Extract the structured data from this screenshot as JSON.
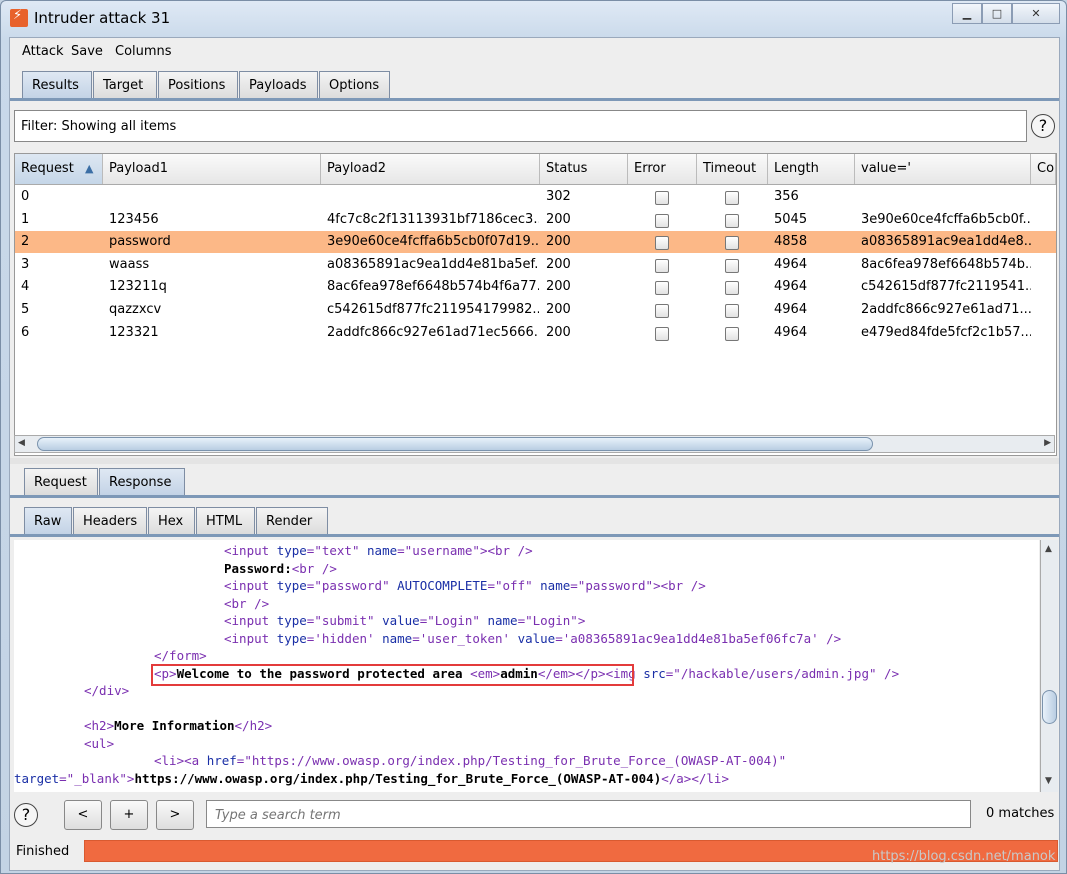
{
  "window": {
    "title": "Intruder attack 31",
    "controls": {
      "minimize": "▁",
      "maximize": "□",
      "close": "✕"
    }
  },
  "menu": [
    "Attack",
    "Save",
    "Columns"
  ],
  "main_tabs": [
    {
      "label": "Results",
      "active": true
    },
    {
      "label": "Target",
      "active": false
    },
    {
      "label": "Positions",
      "active": false
    },
    {
      "label": "Payloads",
      "active": false
    },
    {
      "label": "Options",
      "active": false
    }
  ],
  "filter": {
    "text": "Filter: Showing all items",
    "help": "?"
  },
  "table": {
    "columns": [
      "Request",
      "Payload1",
      "Payload2",
      "Status",
      "Error",
      "Timeout",
      "Length",
      "value='",
      "Co"
    ],
    "sort_indicator": "▲",
    "rows": [
      {
        "request": "0",
        "payload1": "",
        "payload2": "",
        "status": "302",
        "length": "356",
        "value": "",
        "selected": false
      },
      {
        "request": "1",
        "payload1": "123456",
        "payload2": "4fc7c8c2f13113931bf7186cec3...",
        "status": "200",
        "length": "5045",
        "value": "3e90e60ce4fcffa6b5cb0f...",
        "selected": false
      },
      {
        "request": "2",
        "payload1": "password",
        "payload2": "3e90e60ce4fcffa6b5cb0f07d19...",
        "status": "200",
        "length": "4858",
        "value": "a08365891ac9ea1dd4e8...",
        "selected": true
      },
      {
        "request": "3",
        "payload1": "waass",
        "payload2": "a08365891ac9ea1dd4e81ba5ef...",
        "status": "200",
        "length": "4964",
        "value": "8ac6fea978ef6648b574b...",
        "selected": false
      },
      {
        "request": "4",
        "payload1": "123211q",
        "payload2": "8ac6fea978ef6648b574b4f6a77...",
        "status": "200",
        "length": "4964",
        "value": "c542615df877fc2119541...",
        "selected": false
      },
      {
        "request": "5",
        "payload1": "qazzxcv",
        "payload2": "c542615df877fc211954179982...",
        "status": "200",
        "length": "4964",
        "value": "2addfc866c927e61ad71...",
        "selected": false
      },
      {
        "request": "6",
        "payload1": "123321",
        "payload2": "2addfc866c927e61ad71ec5666...",
        "status": "200",
        "length": "4964",
        "value": "e479ed84fde5fcf2c1b57...",
        "selected": false
      }
    ]
  },
  "detail_tabs": [
    {
      "label": "Request",
      "active": false
    },
    {
      "label": "Response",
      "active": true
    }
  ],
  "view_tabs": [
    {
      "label": "Raw",
      "active": true
    },
    {
      "label": "Headers",
      "active": false
    },
    {
      "label": "Hex",
      "active": false
    },
    {
      "label": "HTML",
      "active": false
    },
    {
      "label": "Render",
      "active": false
    }
  ],
  "code_lines": [
    [
      [
        "tag",
        "<input "
      ],
      [
        "attr",
        "type"
      ],
      [
        "tag",
        "=\""
      ],
      [
        "val",
        "text"
      ],
      [
        "tag",
        "\" "
      ],
      [
        "attr",
        "name"
      ],
      [
        "tag",
        "=\""
      ],
      [
        "val",
        "username"
      ],
      [
        "tag",
        "\"><br />"
      ]
    ],
    [
      [
        "txt",
        "Password:"
      ],
      [
        "tag",
        "<br />"
      ]
    ],
    [
      [
        "tag",
        "<input "
      ],
      [
        "attr",
        "type"
      ],
      [
        "tag",
        "=\""
      ],
      [
        "val",
        "password"
      ],
      [
        "tag",
        "\" "
      ],
      [
        "attr",
        "AUTOCOMPLETE"
      ],
      [
        "tag",
        "=\""
      ],
      [
        "val",
        "off"
      ],
      [
        "tag",
        "\" "
      ],
      [
        "attr",
        "name"
      ],
      [
        "tag",
        "=\""
      ],
      [
        "val",
        "password"
      ],
      [
        "tag",
        "\"><br />"
      ]
    ],
    [
      [
        "tag",
        "<br />"
      ]
    ],
    [
      [
        "tag",
        "<input "
      ],
      [
        "attr",
        "type"
      ],
      [
        "tag",
        "=\""
      ],
      [
        "val",
        "submit"
      ],
      [
        "tag",
        "\" "
      ],
      [
        "attr",
        "value"
      ],
      [
        "tag",
        "=\""
      ],
      [
        "val",
        "Login"
      ],
      [
        "tag",
        "\" "
      ],
      [
        "attr",
        "name"
      ],
      [
        "tag",
        "=\""
      ],
      [
        "val",
        "Login"
      ],
      [
        "tag",
        "\">"
      ]
    ],
    [
      [
        "tag",
        "<input "
      ],
      [
        "attr",
        "type"
      ],
      [
        "tag",
        "='"
      ],
      [
        "val",
        "hidden"
      ],
      [
        "tag",
        "' "
      ],
      [
        "attr",
        "name"
      ],
      [
        "tag",
        "='"
      ],
      [
        "val",
        "user_token"
      ],
      [
        "tag",
        "' "
      ],
      [
        "attr",
        "value"
      ],
      [
        "tag",
        "='"
      ],
      [
        "val",
        "a08365891ac9ea1dd4e81ba5ef06fc7a"
      ],
      [
        "tag",
        "' />"
      ]
    ],
    [
      [
        "tag",
        "</form>"
      ]
    ],
    [
      [
        "tag",
        "<p>"
      ],
      [
        "txt",
        "Welcome to the password protected area "
      ],
      [
        "tag",
        "<em>"
      ],
      [
        "txt",
        "admin"
      ],
      [
        "tag",
        "</em></p>"
      ],
      [
        "tag",
        "<img "
      ],
      [
        "attr",
        "src"
      ],
      [
        "tag",
        "=\""
      ],
      [
        "val",
        "/hackable/users/admin.jpg"
      ],
      [
        "tag",
        "\" />"
      ]
    ],
    [
      [
        "tag",
        "</div>"
      ]
    ],
    [
      [
        "tag",
        ""
      ]
    ],
    [
      [
        "tag",
        "<h2>"
      ],
      [
        "txt",
        "More Information"
      ],
      [
        "tag",
        "</h2>"
      ]
    ],
    [
      [
        "tag",
        "<ul>"
      ]
    ],
    [
      [
        "tag",
        "<li><a "
      ],
      [
        "attr",
        "href"
      ],
      [
        "tag",
        "=\""
      ],
      [
        "val",
        "https://www.owasp.org/index.php/Testing_for_Brute_Force_(OWASP-AT-004)"
      ],
      [
        "tag",
        "\""
      ]
    ],
    [
      [
        "attr",
        "target"
      ],
      [
        "tag",
        "=\""
      ],
      [
        "val",
        "_blank"
      ],
      [
        "tag",
        "\">"
      ],
      [
        "txt",
        "https://www.owasp.org/index.php/Testing_for_Brute_Force_(OWASP-AT-004)"
      ],
      [
        "tag",
        "</a></li>"
      ]
    ]
  ],
  "search": {
    "placeholder": "Type a search term",
    "matches": "0 matches",
    "prev": "<",
    "add": "+",
    "next": ">",
    "help": "?"
  },
  "status": {
    "text": "Finished",
    "progress": 1.0
  },
  "watermark": "https://blog.csdn.net/manok",
  "colors": {
    "selected_row": "#fcb887",
    "progress": "#f06a40",
    "highlight_box": "#e33b3b"
  }
}
